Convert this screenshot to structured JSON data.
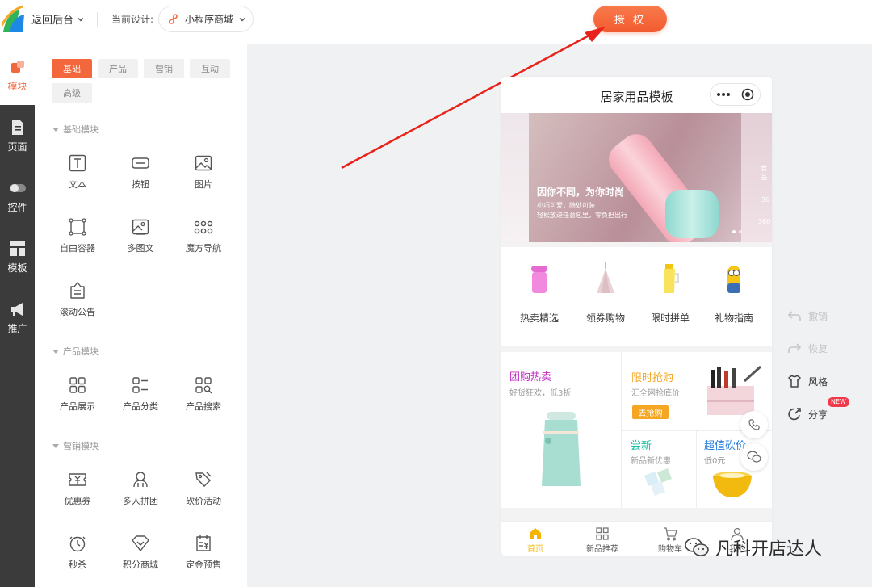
{
  "header": {
    "back_label": "返回后台",
    "current_design_label": "当前设计:",
    "current_design_value": "小程序商城",
    "authorize_button": "授 权"
  },
  "rail": {
    "items": [
      {
        "label": "模块",
        "icon": "blocks-icon"
      },
      {
        "label": "页面",
        "icon": "page-icon"
      },
      {
        "label": "控件",
        "icon": "toggle-icon"
      },
      {
        "label": "模板",
        "icon": "template-icon"
      },
      {
        "label": "推广",
        "icon": "megaphone-icon"
      }
    ]
  },
  "panel": {
    "tabs": [
      "基础",
      "产品",
      "营销",
      "互动",
      "高级"
    ],
    "sections": [
      {
        "title": "基础模块",
        "items": [
          "文本",
          "按钮",
          "图片",
          "自由容器",
          "多图文",
          "魔方导航",
          "滚动公告"
        ]
      },
      {
        "title": "产品模块",
        "items": [
          "产品展示",
          "产品分类",
          "产品搜索"
        ]
      },
      {
        "title": "营销模块",
        "items": [
          "优惠券",
          "多人拼团",
          "砍价活动",
          "秒杀",
          "积分商城",
          "定金预售"
        ]
      }
    ]
  },
  "phone": {
    "title": "居家用品模板",
    "banner": {
      "headline": "因你不同，为你时尚",
      "line1": "小巧可爱，随处可装",
      "line2": "轻松放进任意包里，零负担出行",
      "side1": "食品",
      "side2": "36",
      "side3": "360"
    },
    "categories": [
      "热卖精选",
      "领券购物",
      "限时拼单",
      "礼物指南"
    ],
    "promo": {
      "group_title": "团购热卖",
      "group_sub": "好货狂欢，低3折",
      "flash_title": "限时抢购",
      "flash_sub": "汇全网抢底价",
      "flash_button": "去抢购",
      "new_title": "尝新",
      "new_sub": "新品新优惠",
      "bargain_title": "超值砍价",
      "bargain_sub": "低0元",
      "colors": {
        "group": "#c02dc4",
        "flash": "#f5a623",
        "new": "#1dbfa6",
        "bargain": "#2a7fe0"
      }
    },
    "tabbar": [
      "首页",
      "新品推荐",
      "购物车",
      "我的"
    ]
  },
  "tools": {
    "undo": "撤销",
    "redo": "恢复",
    "style": "风格",
    "share": "分享",
    "share_badge": "NEW"
  },
  "watermark": "凡科开店达人",
  "colors": {
    "accent": "#f2683c",
    "rail": "#3b3b3b"
  }
}
